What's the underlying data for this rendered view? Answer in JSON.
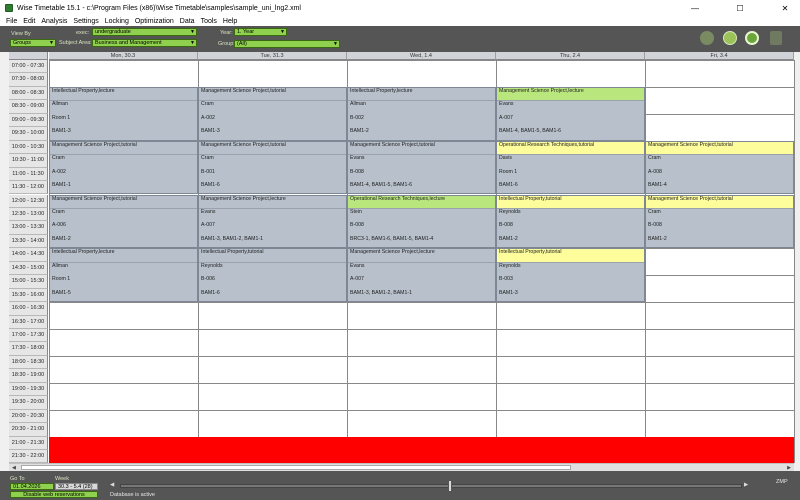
{
  "window": {
    "title": "Wise Timetable 15.1 - c:\\Program Files (x86)\\Wise Timetable\\samples\\sample_uni_lng2.xml",
    "minimize": "—",
    "maximize": "☐",
    "close": "✕"
  },
  "menu": [
    "File",
    "Edit",
    "Analysis",
    "Settings",
    "Locking",
    "Optimization",
    "Data",
    "Tools",
    "Help"
  ],
  "toolbar": {
    "view_by_label": "View By",
    "view_by_value": "Groups",
    "exec_label": "exec:",
    "exec_value": "undergraduate",
    "subject_area_label": "Subject Area:",
    "subject_area_value": "Business and Management",
    "year_label": "Year:",
    "year_value": "1. Year",
    "group_label": "Group:",
    "group_value": "(All)"
  },
  "colors": {
    "toolbar_bg": "#555555",
    "select_green": "#8fd14f",
    "lesson_bg": "#b7c0cb",
    "highlight_green": "#b9e77d",
    "highlight_yellow": "#fdfd9c",
    "blocked_red": "#ff0000"
  },
  "days": [
    "Mon, 30.3",
    "Tue, 31.3",
    "Wed, 1.4",
    "Thu, 2.4",
    "Fri, 3.4"
  ],
  "times": [
    "07:00 - 07:30",
    "07:30 - 08:00",
    "08:00 - 08:30",
    "08:30 - 09:00",
    "09:00 - 09:30",
    "09:30 - 10:00",
    "10:00 - 10:30",
    "10:30 - 11:00",
    "11:00 - 11:30",
    "11:30 - 12:00",
    "12:00 - 12:30",
    "12:30 - 13:00",
    "13:00 - 13:30",
    "13:30 - 14:00",
    "14:00 - 14:30",
    "14:30 - 15:00",
    "15:00 - 15:30",
    "15:30 - 16:00",
    "16:00 - 16:30",
    "16:30 - 17:00",
    "17:00 - 17:30",
    "17:30 - 18:00",
    "18:00 - 18:30",
    "18:30 - 19:00",
    "19:00 - 19:30",
    "19:30 - 20:00",
    "20:00 - 20:30",
    "20:30 - 21:00",
    "21:00 - 21:30",
    "21:30 - 22:00"
  ],
  "lessons": [
    {
      "day": 0,
      "slot": 2,
      "title": "Intellectual Property,lecture",
      "teacher": "Allman",
      "room": "Room 1",
      "groups": "BAM1-3",
      "hl": ""
    },
    {
      "day": 0,
      "slot": 6,
      "title": "Management Science Project,tutorial",
      "teacher": "Cram",
      "room": "A-002",
      "groups": "BAM1-1",
      "hl": ""
    },
    {
      "day": 0,
      "slot": 10,
      "title": "Management Science Project,tutorial",
      "teacher": "Cram",
      "room": "A-006",
      "groups": "BAM1-2",
      "hl": ""
    },
    {
      "day": 0,
      "slot": 14,
      "title": "Intellectual Property,lecture",
      "teacher": "Allman",
      "room": "Room 1",
      "groups": "BAM1-5",
      "hl": ""
    },
    {
      "day": 1,
      "slot": 2,
      "title": "Management Science Project,tutorial",
      "teacher": "Cram",
      "room": "A-002",
      "groups": "BAM1-3",
      "hl": ""
    },
    {
      "day": 1,
      "slot": 6,
      "title": "Management Science Project,tutorial",
      "teacher": "Cram",
      "room": "B-001",
      "groups": "BAM1-6",
      "hl": ""
    },
    {
      "day": 1,
      "slot": 10,
      "title": "Management Science Project,lecture",
      "teacher": "Evans",
      "room": "A-007",
      "groups": "BAM1-3, BAM1-2, BAM1-1",
      "hl": ""
    },
    {
      "day": 1,
      "slot": 14,
      "title": "Intellectual Property,tutorial",
      "teacher": "Reynolds",
      "room": "B-006",
      "groups": "BAM1-6",
      "hl": ""
    },
    {
      "day": 2,
      "slot": 2,
      "title": "Intellectual Property,lecture",
      "teacher": "Allman",
      "room": "B-002",
      "groups": "BAM1-2",
      "hl": ""
    },
    {
      "day": 2,
      "slot": 6,
      "title": "Management Science Project,tutorial",
      "teacher": "Evans",
      "room": "B-008",
      "groups": "BAM1-4, BAM1-5, BAM1-6",
      "hl": ""
    },
    {
      "day": 2,
      "slot": 10,
      "title": "Operational Research Techniques,lecture",
      "teacher": "Stein",
      "room": "B-008",
      "groups": "BRC3-1, BAM1-6, BAM1-5, BAM1-4",
      "hl": "green"
    },
    {
      "day": 2,
      "slot": 14,
      "title": "Management Science Project,lecture",
      "teacher": "Evans",
      "room": "A-007",
      "groups": "BAM1-3, BAM1-2, BAM1-1",
      "hl": ""
    },
    {
      "day": 3,
      "slot": 2,
      "title": "Management Science Project,lecture",
      "teacher": "Evans",
      "room": "A-007",
      "groups": "BAM1-4, BAM1-5, BAM1-6",
      "hl": "green"
    },
    {
      "day": 3,
      "slot": 6,
      "title": "Operational Research Techniques,tutorial",
      "teacher": "Davis",
      "room": "Room 1",
      "groups": "BAM1-6",
      "hl": "yellow"
    },
    {
      "day": 3,
      "slot": 10,
      "title": "Intellectual Property,tutorial",
      "teacher": "Reynolds",
      "room": "B-008",
      "groups": "BAM1-2",
      "hl": "yellow"
    },
    {
      "day": 3,
      "slot": 14,
      "title": "Intellectual Property,tutorial",
      "teacher": "Reynolds",
      "room": "B-003",
      "groups": "BAM1-3",
      "hl": "yellow"
    },
    {
      "day": 4,
      "slot": 6,
      "title": "Management Science Project,tutorial",
      "teacher": "Cram",
      "room": "A-008",
      "groups": "BAM1-4",
      "hl": "yellow"
    },
    {
      "day": 4,
      "slot": 10,
      "title": "Management Science Project,tutorial",
      "teacher": "Cram",
      "room": "B-008",
      "groups": "BAM1-2",
      "hl": "yellow"
    }
  ],
  "status": {
    "go_to_label": "Go To",
    "go_to_value": "01.04.2026",
    "week_label": "Week",
    "week_value": "30.3 - 5.4  (28)",
    "disable_button": "Disable web reservations",
    "db_status": "Database is active",
    "zoom_label": "ZMP",
    "week_position": 0.53
  }
}
